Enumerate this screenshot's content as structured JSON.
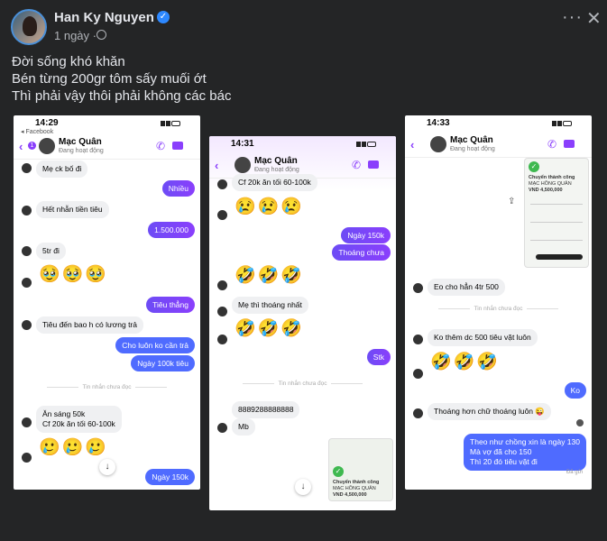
{
  "post": {
    "author": "Han Ky Nguyen",
    "time": "1 ngày ·",
    "more_label": "···",
    "close_label": "✕",
    "caption": [
      "Đời sống khó khăn",
      "Bén từng 200gr tôm sấy muối ớt",
      "Thì phải vậy thôi phải không các bác"
    ]
  },
  "contact": {
    "name": "Mạc Quân",
    "status": "Đang hoạt động"
  },
  "phone1": {
    "time": "14:29",
    "app_back": "◂ Facebook",
    "badge": "1",
    "messages": {
      "m1": "Mẹ ck bố đi",
      "m2": "Nhiều",
      "m3": "Hết nhẫn tiền tiêu",
      "m4": "1.500.000",
      "m5": "5tr đi",
      "emoji1": "🥹🥹🥹",
      "m6": "Tiêu thẳng",
      "m7": "Tiêu đến bao h có lương trả",
      "m8": "Cho luôn ko cần trả",
      "m9": "Ngày 100k tiêu",
      "unread": "Tin nhắn chưa đọc",
      "m10a": "Ăn sáng 50k",
      "m10b": "Cf 20k ăn tối 60-100k",
      "emoji2": "🥲🥲🥲",
      "m11": "Ngày 150k"
    }
  },
  "phone2": {
    "time": "14:31",
    "messages": {
      "m1": "Cf 20k ăn tối 60-100k",
      "emoji1": "😢😢😢",
      "m2": "Ngày 150k",
      "m3": "Thoáng chưa",
      "emoji2": "🤣🤣🤣",
      "m4": "Mẹ thì thoáng nhất",
      "emoji3": "🤣🤣🤣",
      "unread": "Tin nhắn chưa đọc",
      "m5": "Stk",
      "m6": "8889288888888",
      "m7": "Mb",
      "receipt_title": "Chuyển thành công",
      "receipt_name": "MẠC HỒNG QUÂN",
      "receipt_amount": "VND 4,500,000"
    }
  },
  "phone3": {
    "time": "14:33",
    "messages": {
      "receipt_title": "Chuyển thành công",
      "receipt_name": "MẠC HỒNG QUÂN",
      "receipt_amount": "VND 4,500,000",
      "m1": "Eo cho hẳn 4tr 500",
      "unread": "Tin nhắn chưa đọc",
      "m2": "Ko thêm dc 500 tiêu vặt luôn",
      "emoji1": "🤣🤣🤣",
      "m3": "Ko",
      "m4": "Thoáng hơn chữ thoáng luôn 😜",
      "m5a": "Theo như chồng xin là ngày 130",
      "m5b": "Mà vợ đã cho 150",
      "m5c": "Thì 20 đó tiêu vặt đi",
      "seen": "Đã gửi"
    }
  },
  "colors": {
    "bg": "#242526",
    "accent": "#8a3ffc",
    "verified": "#2d88ff"
  }
}
